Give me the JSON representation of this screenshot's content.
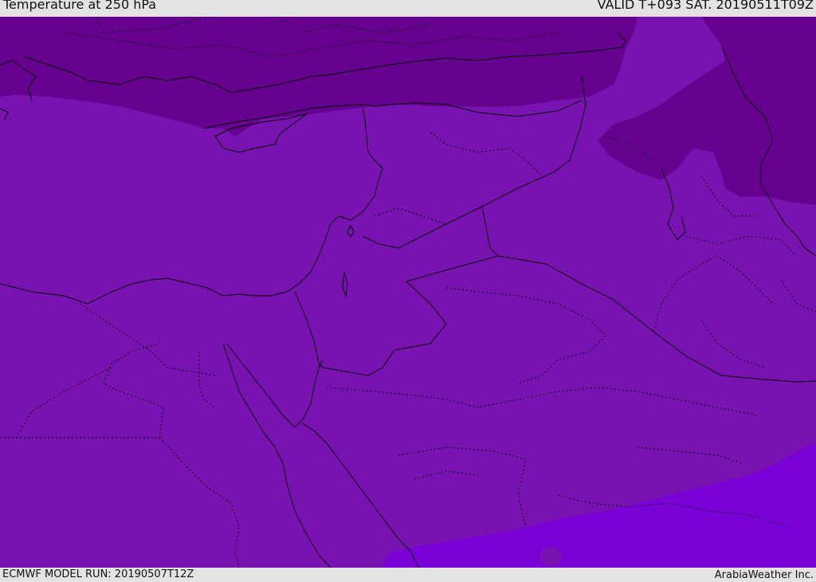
{
  "header": {
    "title": "Temperature at 250 hPa",
    "valid_time": "VALID T+093 SAT. 20190511T09Z"
  },
  "footer": {
    "model_run": "ECMWF MODEL RUN: 20190507T12Z",
    "credit": "ArabiaWeather Inc."
  },
  "colors": {
    "field_main": "#7812b0",
    "field_cold": "#65008f",
    "field_warm": "#7b00d8",
    "boundary": "#000000",
    "frame": "#e3e3e3"
  }
}
